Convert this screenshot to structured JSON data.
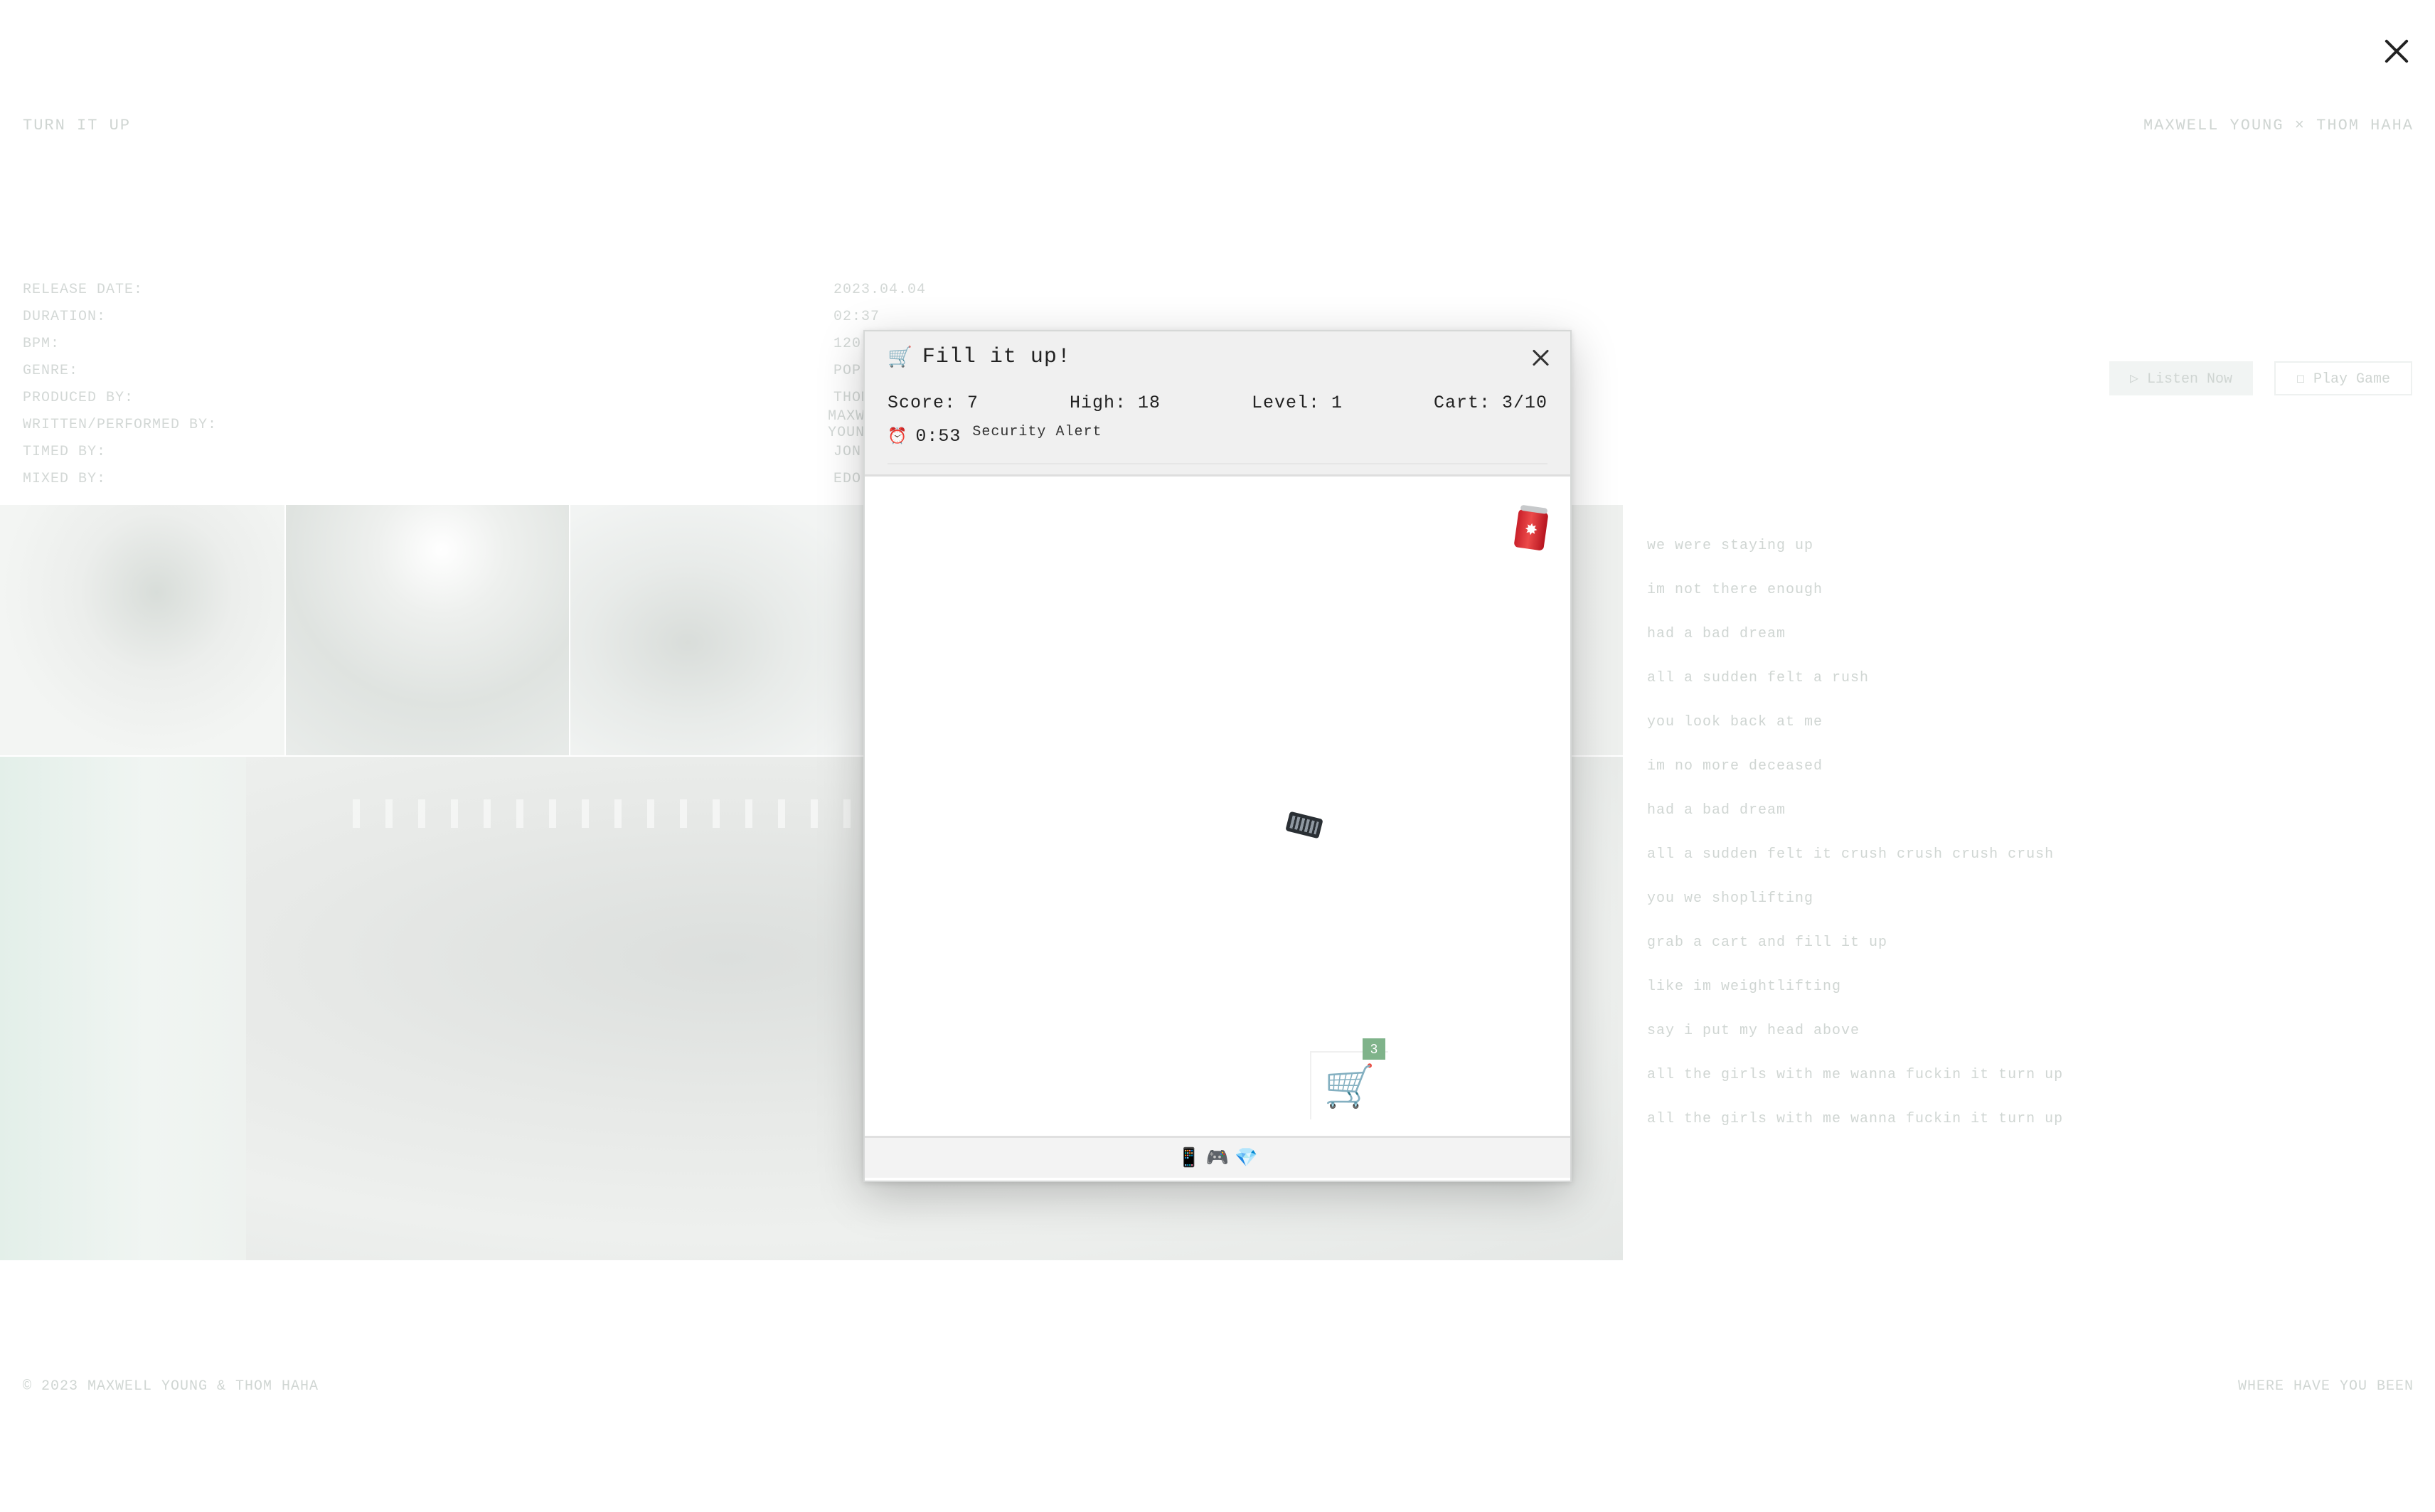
{
  "page": {
    "header_left": "TURN IT UP",
    "header_right": "MAXWELL YOUNG × THOM HAHA",
    "meta": [
      {
        "key": "RELEASE DATE:",
        "value": "2023.04.04"
      },
      {
        "key": "DURATION:",
        "value": "02:37"
      },
      {
        "key": "BPM:",
        "value": "120"
      },
      {
        "key": "GENRE:",
        "value": "POP"
      },
      {
        "key": "PRODUCED BY:",
        "value": "THOM HAHA"
      },
      {
        "key": "WRITTEN/PERFORMED BY:",
        "value": "MAXWELL YOUNG"
      },
      {
        "key": "TIMED BY:",
        "value": "JON"
      },
      {
        "key": "MIXED BY:",
        "value": "EDO"
      }
    ],
    "listen_button": "▷ Listen Now",
    "play_button": "☐ Play Game",
    "lyrics": [
      "we were staying up",
      "im not there enough",
      "had a bad dream",
      "all a sudden felt a rush",
      "you look back at me",
      "im no more deceased",
      "had a bad dream",
      "all a sudden felt it crush crush crush crush",
      "you we shoplifting",
      "grab a cart and fill it up",
      "like im weightlifting",
      "say i put my head above",
      "all the girls with me wanna fuckin it turn up",
      "all the girls with me wanna fuckin it turn up"
    ],
    "footer_left": "© 2023 MAXWELL YOUNG & THOM HAHA",
    "footer_right": "WHERE HAVE YOU BEEN"
  },
  "game": {
    "title_icon": "🛒",
    "title": "Fill it up!",
    "score": "Score: 7",
    "high": "High: 18",
    "level": "Level: 1",
    "cart": "Cart: 3/10",
    "timer_icon": "⏰",
    "timer": "0:53",
    "alert": "Security Alert",
    "cart_count": "3",
    "cart_icon": "🛒",
    "can_icon": "cola-can-icon",
    "keyboard_icon": "keyboard-icon",
    "tray_items": [
      "📱",
      "🎮",
      "💎"
    ]
  }
}
